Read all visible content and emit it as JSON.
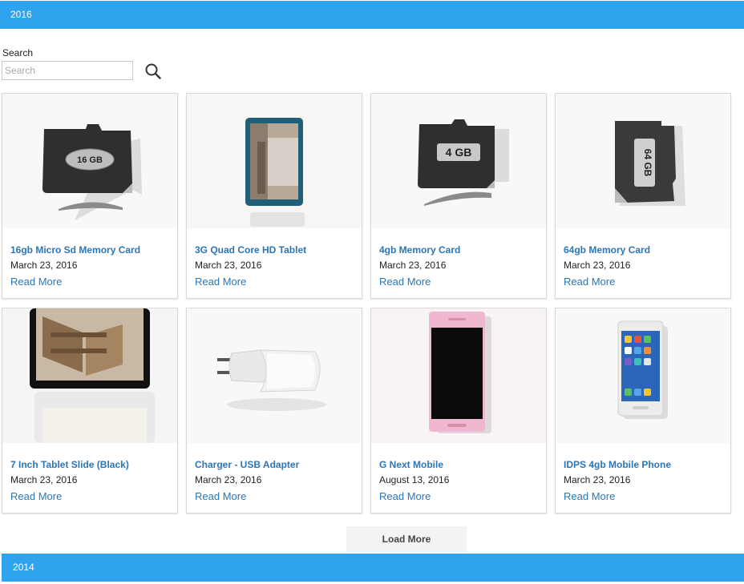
{
  "sections": {
    "top_year": "2016",
    "bottom_year": "2014"
  },
  "search": {
    "label": "Search",
    "placeholder": "Search",
    "icon": "search-icon"
  },
  "products": [
    {
      "title": "16gb Micro Sd Memory Card",
      "date": "March 23, 2016",
      "link": "Read More"
    },
    {
      "title": "3G Quad Core HD Tablet",
      "date": "March 23, 2016",
      "link": "Read More"
    },
    {
      "title": "4gb Memory Card",
      "date": "March 23, 2016",
      "link": "Read More"
    },
    {
      "title": "64gb Memory Card",
      "date": "March 23, 2016",
      "link": "Read More"
    },
    {
      "title": "7 Inch Tablet Slide (Black)",
      "date": "March 23, 2016",
      "link": "Read More"
    },
    {
      "title": "Charger - USB Adapter",
      "date": "March 23, 2016",
      "link": "Read More"
    },
    {
      "title": "G Next Mobile",
      "date": "August 13, 2016",
      "link": "Read More"
    },
    {
      "title": "IDPS 4gb Mobile Phone",
      "date": "March 23, 2016",
      "link": "Read More"
    }
  ],
  "card_labels": {
    "c0": "16 GB",
    "c2": "4 GB",
    "c3": "64 GB"
  },
  "load_more": "Load More",
  "colors": {
    "accent": "#2fa3ee",
    "link": "#2a76b8"
  }
}
